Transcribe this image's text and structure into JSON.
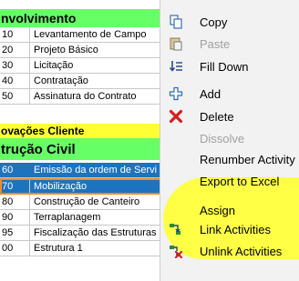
{
  "sections": {
    "envolvimento": "nvolvimento",
    "aprovacoes": "ovações Cliente",
    "construcao": "trução Civil"
  },
  "rows_top": [
    {
      "num": "10",
      "name": "Levantamento de Campo"
    },
    {
      "num": "20",
      "name": "Projeto Básico"
    },
    {
      "num": "30",
      "name": "Licitação"
    },
    {
      "num": "40",
      "name": "Contratação"
    },
    {
      "num": "50",
      "name": "Assinatura do Contrato"
    }
  ],
  "rows_bottom": [
    {
      "num": "60",
      "name": "Emissão da ordem de Servi"
    },
    {
      "num": "70",
      "name": "Mobilização"
    },
    {
      "num": "80",
      "name": "Construção de Canteiro"
    },
    {
      "num": "90",
      "name": "Terraplanagem"
    },
    {
      "num": "95",
      "name": "Fiscalização das Estruturas"
    },
    {
      "num": "00",
      "name": "Estrutura 1"
    }
  ],
  "menu": {
    "copy": "Copy",
    "paste": "Paste",
    "fill_down": "Fill Down",
    "add": "Add",
    "delete": "Delete",
    "dissolve": "Dissolve",
    "renumber": "Renumber Activity",
    "export": "Export to Excel",
    "assign": "Assign",
    "link": "Link Activities",
    "unlink": "Unlink Activities"
  },
  "colors": {
    "section_green": "#66ff66",
    "section_yellow": "#ffff33",
    "selection_blue": "#1e73be",
    "focus_orange": "#f08a24",
    "highlight_yellow": "#ffff3c"
  }
}
